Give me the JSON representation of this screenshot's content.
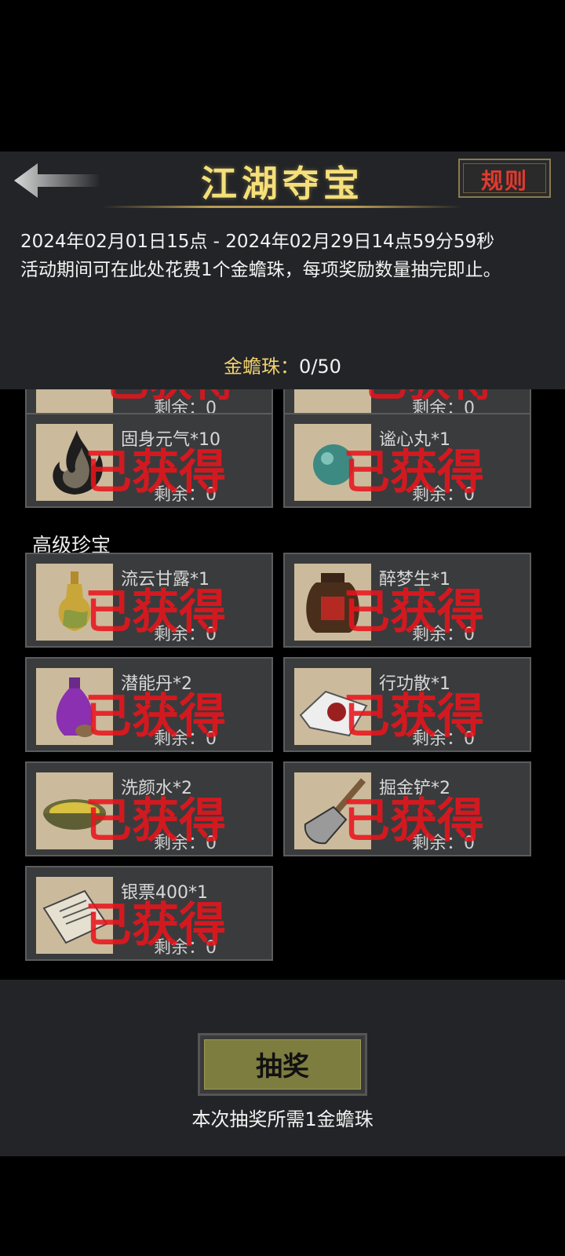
{
  "header": {
    "title": "江湖夺宝",
    "rules_label": "规则"
  },
  "event": {
    "period": "2024年02月01日15点 - 2024年02月29日14点59分59秒",
    "description": "活动期间可在此处花费1个金蟾珠，每项奖励数量抽完即止。"
  },
  "currency": {
    "label": "金蟾珠：",
    "value": "0/50"
  },
  "prizes": {
    "partial_top": [
      {
        "remain": "剩余：0"
      },
      {
        "remain": "剩余：0"
      }
    ],
    "basic": [
      {
        "name": "固身元气*10",
        "remain": "剩余：0",
        "icon": "flame-icon",
        "status": "已获得"
      },
      {
        "name": "谧心丸*1",
        "remain": "剩余：0",
        "icon": "pill-icon",
        "status": "已获得"
      }
    ],
    "advanced_title": "高级珍宝",
    "advanced": [
      {
        "name": "流云甘露*1",
        "remain": "剩余：0",
        "icon": "gourd-icon",
        "status": "已获得"
      },
      {
        "name": "醉梦生*1",
        "remain": "剩余：0",
        "icon": "wine-jar-icon",
        "status": "已获得"
      },
      {
        "name": "潜能丹*2",
        "remain": "剩余：0",
        "icon": "vase-icon",
        "status": "已获得"
      },
      {
        "name": "行功散*1",
        "remain": "剩余：0",
        "icon": "powder-icon",
        "status": "已获得"
      },
      {
        "name": "洗颜水*2",
        "remain": "剩余：0",
        "icon": "bowl-icon",
        "status": "已获得"
      },
      {
        "name": "掘金铲*2",
        "remain": "剩余：0",
        "icon": "shovel-icon",
        "status": "已获得"
      },
      {
        "name": "银票400*1",
        "remain": "剩余：0",
        "icon": "banknote-icon",
        "status": "已获得"
      }
    ]
  },
  "draw": {
    "button_label": "抽奖",
    "cost_note": "本次抽奖所需1金蟾珠"
  },
  "colors": {
    "title_gold": "#f4df7a",
    "stamp_red": "#e8141c",
    "panel": "#222427",
    "card": "#3a3b3d",
    "button_olive": "#7e7d40"
  }
}
